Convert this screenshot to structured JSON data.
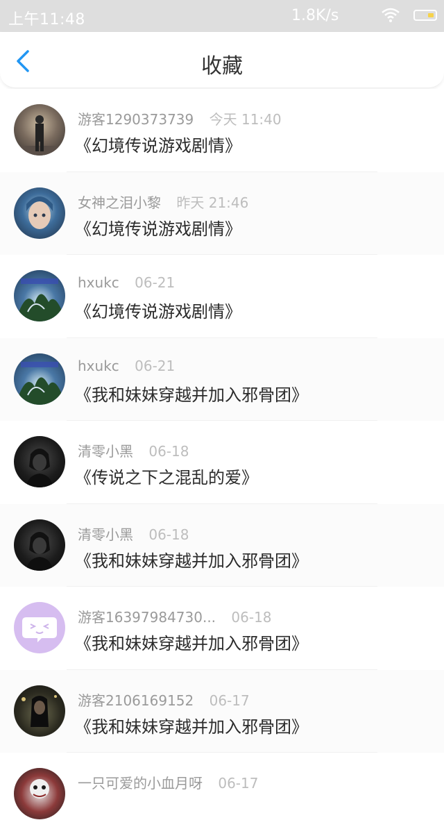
{
  "status_bar": {
    "time": "上午11:48",
    "speed": "1.8K/s",
    "icons": [
      "wifi-icon",
      "battery-icon"
    ]
  },
  "nav": {
    "back_icon": "chevron-left-icon",
    "title": "收藏",
    "accent_color": "#2196f3"
  },
  "items": [
    {
      "author": "游客1290373739",
      "time": "今天 11:40",
      "title": "《幻境传说游戏剧情》"
    },
    {
      "author": "女神之泪小黎",
      "time": "昨天 21:46",
      "title": "《幻境传说游戏剧情》"
    },
    {
      "author": "hxukc",
      "time": "06-21",
      "title": "《幻境传说游戏剧情》"
    },
    {
      "author": "hxukc",
      "time": "06-21",
      "title": "《我和妹妹穿越并加入邪骨团》"
    },
    {
      "author": "清零小黑",
      "time": "06-18",
      "title": "《传说之下之混乱的爱》"
    },
    {
      "author": "清零小黑",
      "time": "06-18",
      "title": "《我和妹妹穿越并加入邪骨团》"
    },
    {
      "author": "游客16397984730...",
      "time": "06-18",
      "title": "《我和妹妹穿越并加入邪骨团》"
    },
    {
      "author": "游客2106169152",
      "time": "06-17",
      "title": "《我和妹妹穿越并加入邪骨团》"
    },
    {
      "author": "一只可爱的小血月呀",
      "time": "06-17",
      "title": ""
    }
  ]
}
